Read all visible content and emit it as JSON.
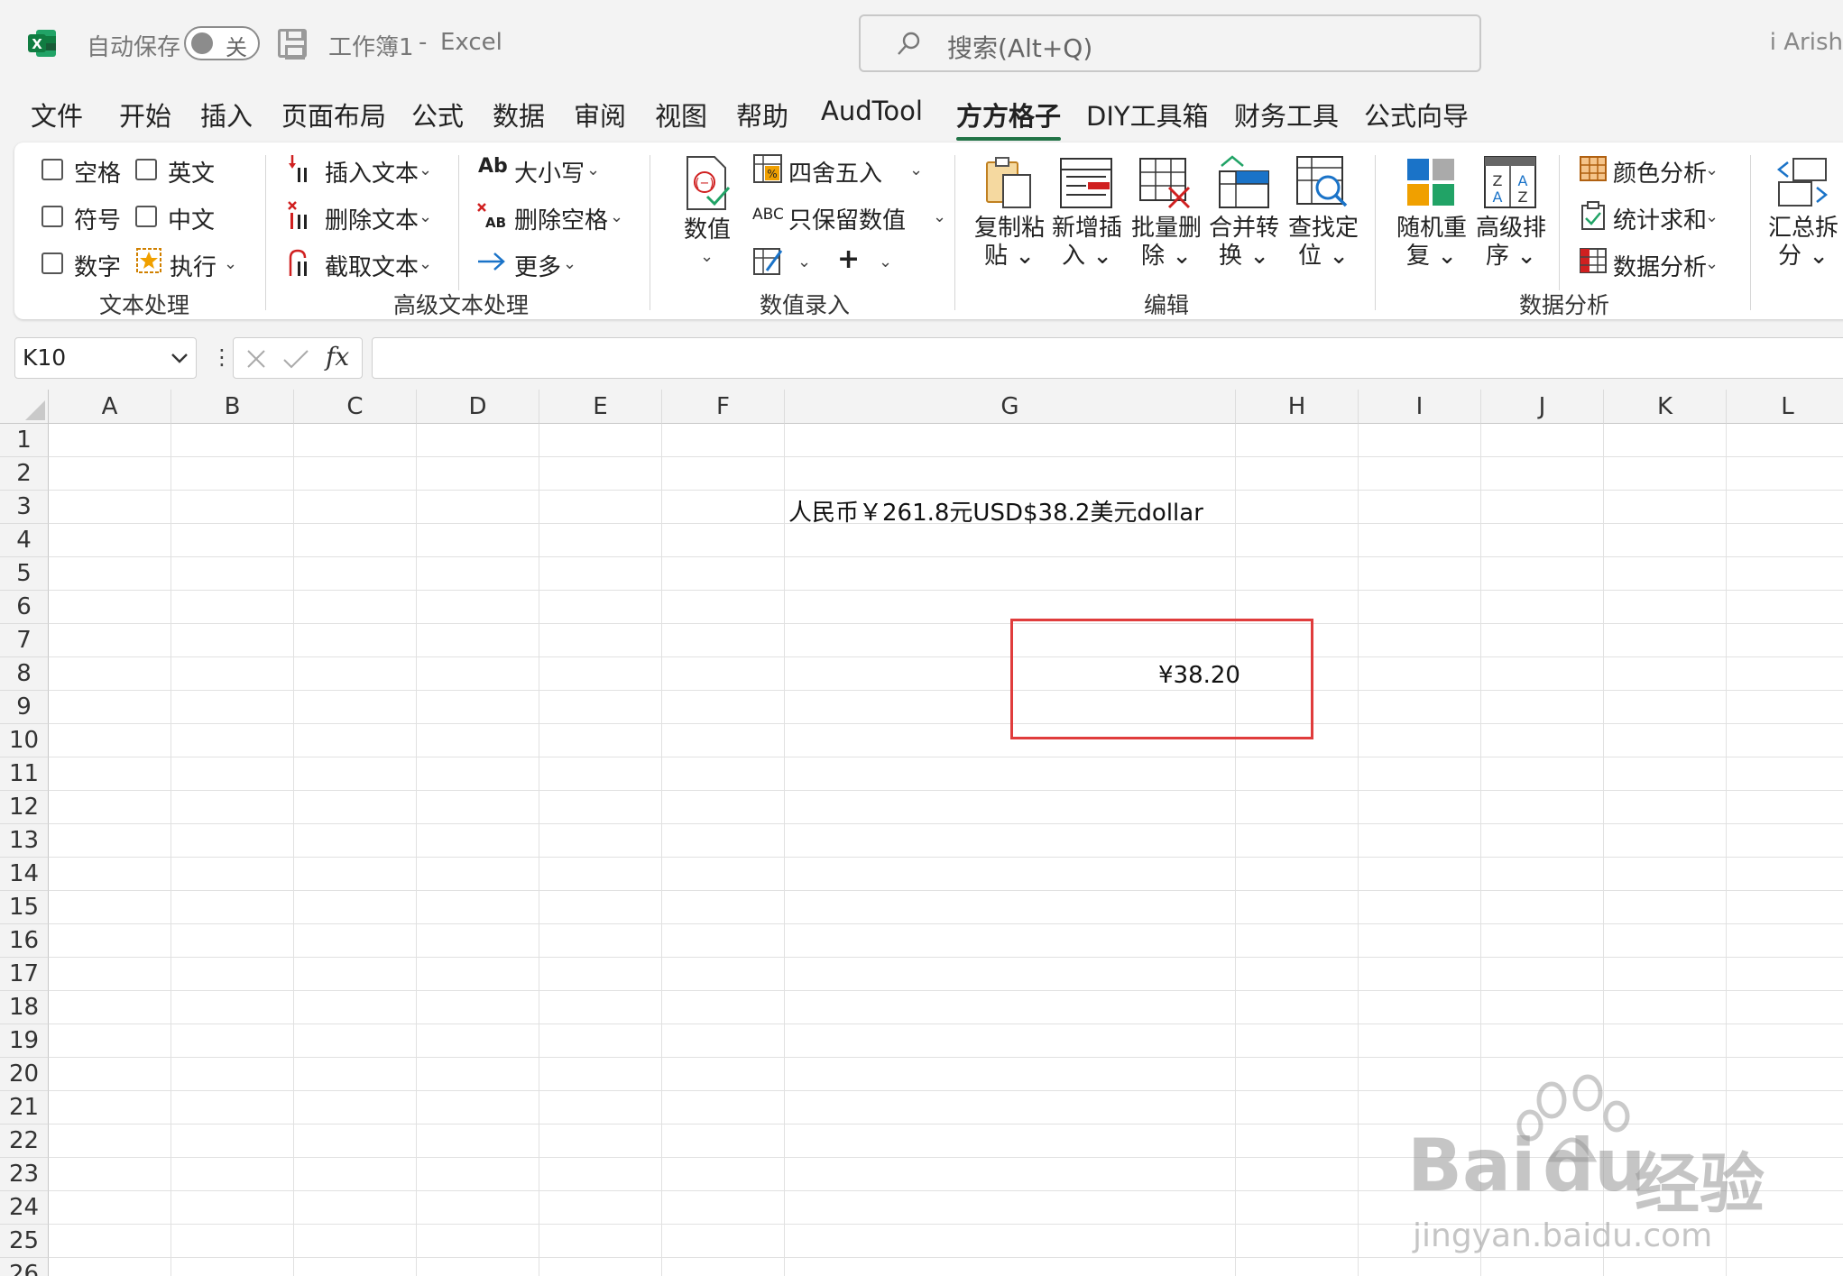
{
  "titlebar": {
    "autosave_label": "自动保存",
    "autosave_state": "关",
    "workbook": "工作簿1",
    "separator": "-",
    "app": "Excel",
    "search_placeholder": "搜索(Alt+Q)",
    "user": "i Arish"
  },
  "menu": [
    "文件",
    "开始",
    "插入",
    "页面布局",
    "公式",
    "数据",
    "审阅",
    "视图",
    "帮助",
    "AudTool",
    "方方格子",
    "DIY工具箱",
    "财务工具",
    "公式向导"
  ],
  "ribbon": {
    "text_processing": {
      "checkboxes": [
        "空格",
        "英文",
        "符号",
        "中文",
        "数字"
      ],
      "execute": "执行",
      "label": "文本处理"
    },
    "advanced_text": {
      "insert_text": "插入文本",
      "delete_text": "删除文本",
      "extract_text": "截取文本",
      "case": "大小写",
      "delete_spaces": "删除空格",
      "more": "更多",
      "label": "高级文本处理"
    },
    "value_entry": {
      "value": "数值",
      "round": "四舍五入",
      "keep_value": "只保留数值",
      "label": "数值录入"
    },
    "edit": {
      "copy_paste": [
        "复制粘",
        "贴"
      ],
      "insert_new": [
        "新增插",
        "入"
      ],
      "batch_delete": [
        "批量删",
        "除"
      ],
      "merge_convert": [
        "合并转",
        "换"
      ],
      "find_locate": [
        "查找定",
        "位"
      ],
      "label": "编辑"
    },
    "data_analysis": {
      "random_repeat": [
        "随机重",
        "复"
      ],
      "advanced_sort": [
        "高级排",
        "序"
      ],
      "color_analysis": "颜色分析",
      "stat_sum": "统计求和",
      "data_analysis": "数据分析",
      "label": "数据分析"
    },
    "summary": [
      "汇总拆",
      "分"
    ]
  },
  "formula_bar": {
    "name_box": "K10",
    "fx": "fx",
    "content": ""
  },
  "sheet": {
    "columns": [
      "A",
      "B",
      "C",
      "D",
      "E",
      "F",
      "G",
      "H",
      "I",
      "J",
      "K",
      "L"
    ],
    "rows": [
      "1",
      "2",
      "3",
      "4",
      "5",
      "6",
      "7",
      "8",
      "9",
      "10",
      "11",
      "12",
      "13",
      "14",
      "15",
      "16",
      "17",
      "18",
      "19",
      "20",
      "21",
      "22",
      "23",
      "24",
      "25",
      "26"
    ],
    "cell_g3": "人民币￥261.8元USD$38.2美元dollar",
    "cell_h8": "¥38.20"
  },
  "watermark": {
    "brand": "Bai",
    "brand2": "du",
    "brand_cn": "经验",
    "url": "jingyan.baidu.com"
  },
  "colors": {
    "excel_green": "#217346",
    "highlight_red": "#e03c3c"
  }
}
